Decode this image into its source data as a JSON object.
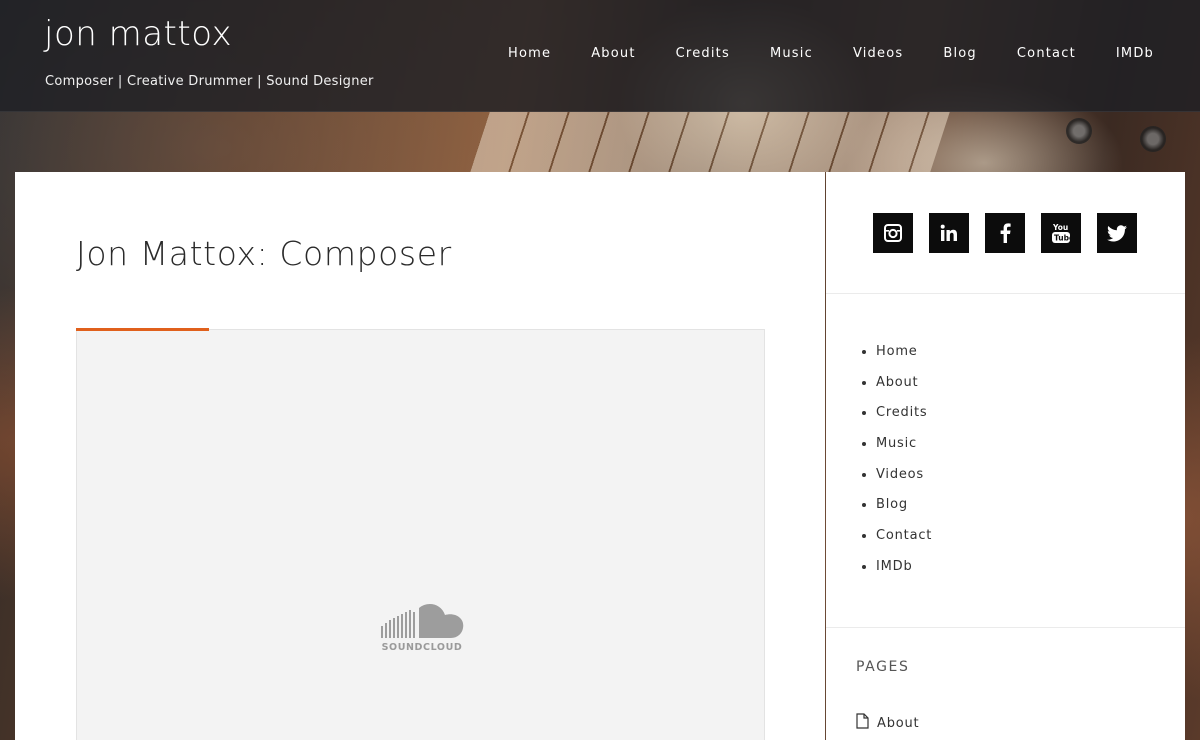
{
  "header": {
    "site_title": "jon mattox",
    "tagline": "Composer | Creative Drummer | Sound Designer",
    "nav": [
      "Home",
      "About",
      "Credits",
      "Music",
      "Videos",
      "Blog",
      "Contact",
      "IMDb"
    ]
  },
  "main": {
    "page_title": "Jon Mattox: Composer",
    "embed": {
      "logo_text": "SOUNDCLOUD",
      "icon": "soundcloud-icon"
    },
    "accent_color": "#e0601c"
  },
  "sidebar": {
    "social": [
      {
        "icon": "instagram-icon"
      },
      {
        "icon": "linkedin-icon"
      },
      {
        "icon": "facebook-icon"
      },
      {
        "icon": "youtube-icon"
      },
      {
        "icon": "twitter-icon"
      }
    ],
    "menu": [
      "Home",
      "About",
      "Credits",
      "Music",
      "Videos",
      "Blog",
      "Contact",
      "IMDb"
    ],
    "pages_widget": {
      "title": "PAGES",
      "items": [
        "About"
      ],
      "icon": "page-icon"
    }
  }
}
